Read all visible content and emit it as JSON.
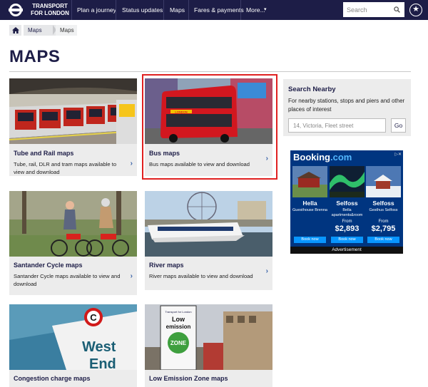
{
  "nav": {
    "logo_line1": "TRANSPORT",
    "logo_line2": "FOR LONDON",
    "items": [
      "Plan a journey",
      "Status updates",
      "Maps",
      "Fares & payments",
      "More...",
      "▾"
    ],
    "search_placeholder": "Search"
  },
  "breadcrumb": {
    "items": [
      "Maps",
      "Maps"
    ]
  },
  "page": {
    "title": "MAPS"
  },
  "cards": [
    {
      "title": "Tube and Rail maps",
      "desc": "Tube, rail, DLR and tram maps available to view and download"
    },
    {
      "title": "Bus maps",
      "desc": "Bus maps available to view and download"
    },
    {
      "title": "Santander Cycle maps",
      "desc": "Santander Cycle maps available to view and download"
    },
    {
      "title": "River maps",
      "desc": "River maps available to view and download"
    },
    {
      "title": "Congestion charge maps",
      "desc": ""
    },
    {
      "title": "Low Emission Zone maps",
      "desc": ""
    }
  ],
  "image_text": {
    "bus_front": "LONDON",
    "sign_c": "C",
    "sign_west": "West",
    "sign_end": "End",
    "lez_top": "Transport for London",
    "lez_low": "Low",
    "lez_emission": "emission",
    "lez_zone": "ZONE"
  },
  "sidebar": {
    "nearby_title": "Search Nearby",
    "nearby_desc": "For nearby stations, stops and piers and other places of interest",
    "nearby_placeholder": "14, Victoria, Fleet street",
    "go_label": "Go"
  },
  "ad": {
    "brand": "Booking",
    "brand_suffix": ".com",
    "footer": "Advertisement",
    "hotels": [
      {
        "name": "Hella",
        "sub": "Guesthouse Brenna",
        "from": "",
        "price": "",
        "book": "Book now"
      },
      {
        "name": "Selfoss",
        "sub": "Bella apartments&room",
        "from": "From",
        "price": "$2,893",
        "book": "Book now"
      },
      {
        "name": "Selfoss",
        "sub": "Gesthus Selfoss",
        "from": "From",
        "price": "$2,795",
        "book": "Book now"
      }
    ]
  },
  "colors": {
    "navy": "#1d1d47",
    "highlight": "#e02020",
    "booking_blue": "#003580"
  }
}
